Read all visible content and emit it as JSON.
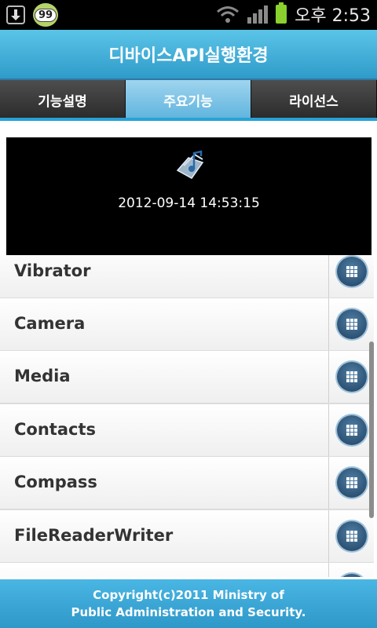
{
  "status_bar": {
    "notification_badge": "99",
    "time": "오후 2:53",
    "icons": [
      "download-icon",
      "paw-notification-icon",
      "wifi-icon",
      "signal-icon",
      "battery-icon"
    ]
  },
  "app": {
    "title": "디바이스API실행환경"
  },
  "tabs": [
    {
      "label": "기능설명",
      "active": false
    },
    {
      "label": "주요기능",
      "active": true
    },
    {
      "label": "라이선스",
      "active": false
    }
  ],
  "player": {
    "timestamp": "2012-09-14 14:53:15",
    "icon": "music-icon"
  },
  "list": {
    "items": [
      {
        "label": "Vibrator"
      },
      {
        "label": "Camera"
      },
      {
        "label": "Media"
      },
      {
        "label": "Contacts"
      },
      {
        "label": "Compass"
      },
      {
        "label": "FileReaderWriter"
      },
      {
        "label": ""
      }
    ],
    "item_icon": "grid-icon"
  },
  "footer": {
    "line1": "Copyright(c)2011 Ministry of",
    "line2": "Public Administration and Security."
  },
  "colors": {
    "accent": "#2f9bc9",
    "active_tab": "#5fb4de"
  }
}
